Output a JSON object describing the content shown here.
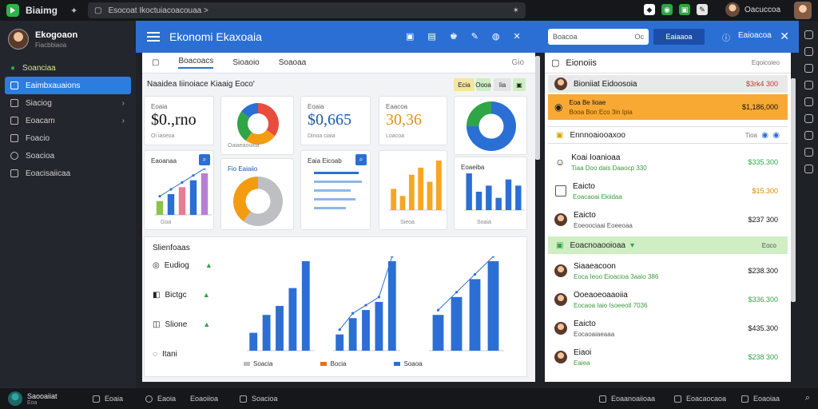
{
  "topbar": {
    "app_title": "Biaimg",
    "url": "Esocoat Ikoctuiacoacouaa  >",
    "user_name": "Oacuccoa",
    "notif_count": "2"
  },
  "sidebar": {
    "user_name": "Ekogoaon",
    "user_sub": "Fiacbbiaoa",
    "items": [
      {
        "label": "Soanciaa"
      },
      {
        "label": "Eaimbxauaions"
      },
      {
        "label": "Siaciog"
      },
      {
        "label": "Eoacam"
      },
      {
        "label": "Foacio"
      },
      {
        "label": "Soacioa"
      },
      {
        "label": "Eoacisaiicaa"
      }
    ]
  },
  "header": {
    "title": "Ekonomi Ekaxoaia",
    "search_placeholder": "Boacoa",
    "search_suffix": "Oc",
    "button_label": "Eaiaaoa",
    "info_label": "Eaioacoa"
  },
  "content": {
    "tabs": [
      "Boacoacs",
      "Sioaoio",
      "Soaoaa"
    ],
    "tabs_right": "Gio",
    "section_title": "Naaidea Iiinoiace Kiaaig Eoco'",
    "pills": [
      "Ecia",
      "Oooa",
      "Iia"
    ],
    "stats": [
      {
        "label": "Eoaia",
        "value": "$0.,rno",
        "sub": "Oi iaseoa"
      },
      {
        "label": "Eoaia",
        "value": "$0,665",
        "sub": "Dinoa ciaia"
      },
      {
        "label": "Eaacoa",
        "value": "30,36",
        "sub": "Loacoa"
      }
    ],
    "mini_charts": [
      {
        "title": "Eaoanaa",
        "footer": "Goa"
      },
      {
        "title": "Eaia Eicoab",
        "footer": "Sieoa"
      },
      {
        "title": "Eoaeiba",
        "footer": "Soaia"
      }
    ],
    "donut_caption": "Oaiaeaouioa",
    "donut2_caption": "Fio Eaiaiio",
    "panel_title": "Slienfoaas",
    "panel_list": [
      {
        "label": "Eudiog"
      },
      {
        "label": "Bictgc"
      },
      {
        "label": "Slione"
      },
      {
        "label": "Itani"
      }
    ],
    "legend": [
      "Soacia",
      "Bocia",
      "Soaoa"
    ]
  },
  "chart_data": [
    {
      "type": "pie",
      "values": [
        35,
        25,
        25,
        15
      ],
      "colors": [
        "#e84c3d",
        "#f39c12",
        "#2fa545",
        "#2b6fd4"
      ]
    },
    {
      "type": "bar",
      "values": [
        2,
        3,
        4,
        5,
        6
      ],
      "colors": [
        "#8bc34a",
        "#2b6fd4",
        "#e67e91",
        "#2b6fd4",
        "#b57fd4"
      ]
    },
    {
      "type": "pie",
      "values": [
        60,
        40
      ],
      "colors": [
        "#bdbfc3",
        "#f39c12"
      ]
    },
    {
      "type": "bar",
      "values": [
        3,
        2,
        5,
        6,
        4,
        7
      ],
      "colors": [
        "#f5a623"
      ]
    },
    {
      "type": "pie",
      "values": [
        75,
        25
      ],
      "colors": [
        "#2b6fd4",
        "#2fa545"
      ]
    },
    {
      "type": "bar",
      "values": [
        6,
        3,
        4,
        2,
        5,
        4
      ],
      "colors": [
        "#2b6fd4"
      ]
    },
    {
      "type": "bar",
      "values": [
        2,
        4,
        5,
        7,
        10
      ],
      "color": "#2b6fd4"
    },
    {
      "type": "bar",
      "values": [
        2,
        4,
        5,
        6,
        11
      ],
      "color": "#2b6fd4"
    },
    {
      "type": "bar",
      "values": [
        4,
        6,
        8,
        10
      ],
      "color": "#2b6fd4"
    }
  ],
  "rpanel": {
    "title": "Eionoiis",
    "title_right": "Eqoicoieo",
    "rows": [
      {
        "name": "Bioniiat Eidoosoia",
        "sub": "",
        "amount": "$3rk4 300"
      },
      {
        "name": "Eoa Be Iioae",
        "sub": "Booa Bon Eco 3in  Ipia",
        "amount": "$1,186,000"
      },
      {
        "name": "Ennnoaiooaxoo",
        "sub": "",
        "amount": "Tioa"
      },
      {
        "name": "Koai Ioanioaa",
        "sub": "Tiaa Doo dais Daaocp 330",
        "amount": "$335.300"
      },
      {
        "name": "Eaicto",
        "sub": "Eoacaoai Ekiidaa",
        "amount": "$15.300"
      },
      {
        "name": "Eaicto",
        "sub": "Eoeoociaai Eoeeoaa",
        "amount": "$237 300"
      },
      {
        "name": "Eoacnoaooioaa",
        "sub": "",
        "amount": "Eoco"
      },
      {
        "name": "Siaaeacoon",
        "sub": "Eoca Ieoo Eioacioa 3aaio 386",
        "amount": "$238.300"
      },
      {
        "name": "Ooeaoeoaaoiia",
        "sub": "Eocaoa Iaio Isoeeotl 7036",
        "amount": "$336.300"
      },
      {
        "name": "Eaicto",
        "sub": "Eocaoaiaeaaa",
        "amount": "$435.300"
      },
      {
        "name": "Eiaoi",
        "sub": "Eaiea",
        "amount": "$238 300"
      }
    ]
  },
  "bottombar": {
    "user": "Saooaiiat",
    "user_sub": "Eoa",
    "items": [
      "Eoaia",
      "Eaoia",
      "Eoaoiioa",
      "Soacioa"
    ],
    "right_items": [
      "Eoaanoaiioaa",
      "Eoacaocaoa",
      "Eoaoiaa"
    ]
  },
  "colors": {
    "accent": "#2b6fd4",
    "green": "#2fa545",
    "orange": "#f39c12",
    "highlight_row": "#f7a934",
    "green_header": "#cfeec4"
  }
}
